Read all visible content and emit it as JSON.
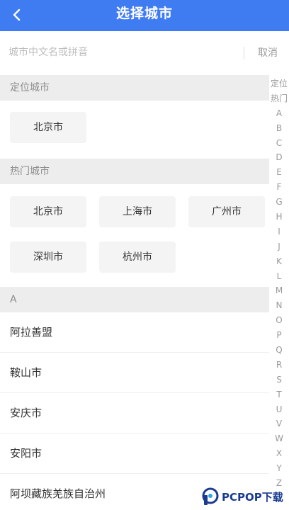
{
  "header": {
    "title": "选择城市"
  },
  "search": {
    "placeholder": "城市中文名或拼音",
    "cancel_label": "取消"
  },
  "sections": {
    "location": {
      "title": "定位城市",
      "cities": [
        "北京市"
      ]
    },
    "hot": {
      "title": "热门城市",
      "cities": [
        "北京市",
        "上海市",
        "广州市",
        "深圳市",
        "杭州市"
      ]
    },
    "a": {
      "title": "A",
      "cities": [
        "阿拉善盟",
        "鞍山市",
        "安庆市",
        "安阳市",
        "阿坝藏族羌族自治州"
      ]
    }
  },
  "index_bar": [
    "定位",
    "热门",
    "A",
    "B",
    "C",
    "D",
    "E",
    "F",
    "G",
    "H",
    "I",
    "J",
    "K",
    "L",
    "M",
    "N",
    "O",
    "P",
    "Q",
    "R",
    "S",
    "T",
    "U",
    "V",
    "W",
    "X",
    "Y",
    "Z"
  ],
  "watermark": {
    "text": "PCPOP下载"
  },
  "colors": {
    "header": "#3f7cf2",
    "section_bg": "#ededed",
    "chip_bg": "#f4f4f4"
  },
  "icons": {
    "back": "chevron-left-icon",
    "watermark_logo": "pcpop-logo-icon"
  }
}
